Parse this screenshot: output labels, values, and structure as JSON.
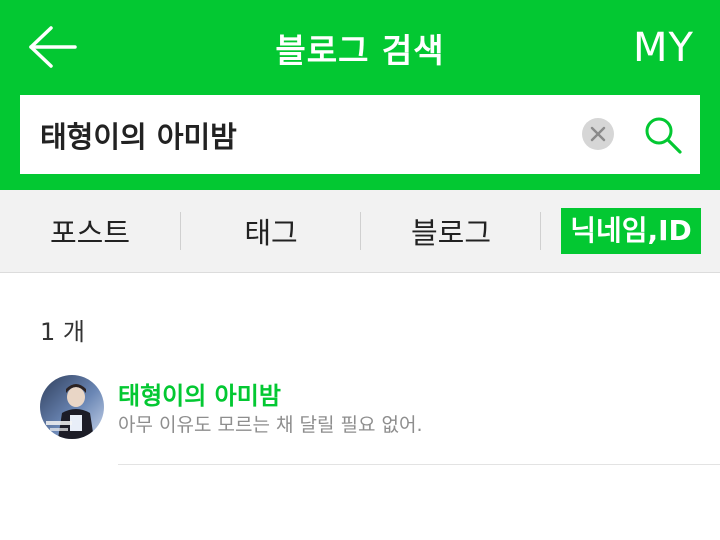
{
  "header": {
    "title": "블로그 검색",
    "my_label": "MY",
    "background_color": "#03c832"
  },
  "search": {
    "value": "태형이의 아미밤",
    "placeholder": "",
    "clear_icon": "close-icon",
    "search_icon": "search-icon"
  },
  "tabs": [
    {
      "label": "포스트",
      "active": false
    },
    {
      "label": "태그",
      "active": false
    },
    {
      "label": "블로그",
      "active": false
    },
    {
      "label": "닉네임,ID",
      "active": true
    }
  ],
  "results": {
    "count_label": "1 개",
    "items": [
      {
        "title": "태형이의 아미밤",
        "description": "아무 이유도 모르는 채 달릴 필요 없어."
      }
    ]
  },
  "colors": {
    "accent": "#03c832",
    "tab_bar": "#f2f2f2",
    "muted_text": "#8e8e8e"
  }
}
